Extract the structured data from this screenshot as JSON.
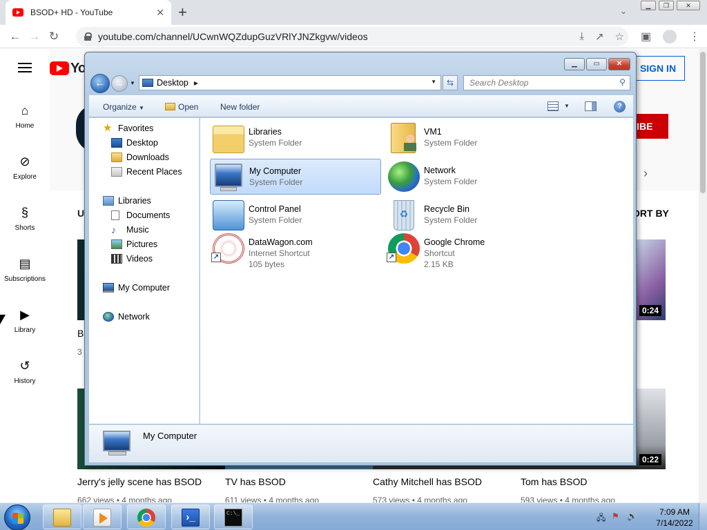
{
  "browser": {
    "tab_title": "BSOD+ HD - YouTube",
    "url": "youtube.com/channel/UCwnWQZdupGuzVRlYJNZkgvw/videos"
  },
  "youtube": {
    "sign_in": "SIGN IN",
    "subscribe_partial": "RIBE",
    "sort_by_partial": "ORT BY",
    "guide": [
      {
        "label": "Home",
        "icon": "home-icon"
      },
      {
        "label": "Explore",
        "icon": "compass-icon"
      },
      {
        "label": "Shorts",
        "icon": "shorts-icon"
      },
      {
        "label": "Subscriptions",
        "icon": "subscriptions-icon"
      },
      {
        "label": "Library",
        "icon": "library-icon"
      },
      {
        "label": "History",
        "icon": "history-icon"
      }
    ],
    "row1_partial_title": "B",
    "row1_partial_meta": "3",
    "row1_section_partial": "U",
    "row1_durations": [
      "0:24"
    ],
    "row2_durations": [
      "0:22"
    ],
    "videos_row2": [
      {
        "title": "Jerry's jelly scene has BSOD",
        "meta": "662 views • 4 months ago"
      },
      {
        "title": "TV has BSOD",
        "meta": "611 views • 4 months ago"
      },
      {
        "title": "Cathy Mitchell has BSOD",
        "meta": "573 views • 4 months ago"
      },
      {
        "title": "Tom has BSOD",
        "meta": "593 views • 4 months ago"
      }
    ]
  },
  "explorer": {
    "address": "Desktop",
    "search_placeholder": "Search Desktop",
    "commands": {
      "organize": "Organize",
      "open": "Open",
      "new_folder": "New folder"
    },
    "nav": {
      "favorites": "Favorites",
      "desktop": "Desktop",
      "downloads": "Downloads",
      "recent_places": "Recent Places",
      "libraries": "Libraries",
      "documents": "Documents",
      "music": "Music",
      "pictures": "Pictures",
      "videos": "Videos",
      "my_computer": "My Computer",
      "network": "Network"
    },
    "items": [
      {
        "name": "Libraries",
        "type": "System Folder"
      },
      {
        "name": "VM1",
        "type": "System Folder"
      },
      {
        "name": "My Computer",
        "type": "System Folder"
      },
      {
        "name": "Network",
        "type": "System Folder"
      },
      {
        "name": "Control Panel",
        "type": "System Folder"
      },
      {
        "name": "Recycle Bin",
        "type": "System Folder"
      },
      {
        "name": "DataWagon.com",
        "type": "Internet Shortcut",
        "size": "105 bytes"
      },
      {
        "name": "Google Chrome",
        "type": "Shortcut",
        "size": "2.15 KB"
      }
    ],
    "details_name": "My Computer"
  },
  "taskbar": {
    "time": "7:09 AM",
    "date": "7/14/2022"
  }
}
